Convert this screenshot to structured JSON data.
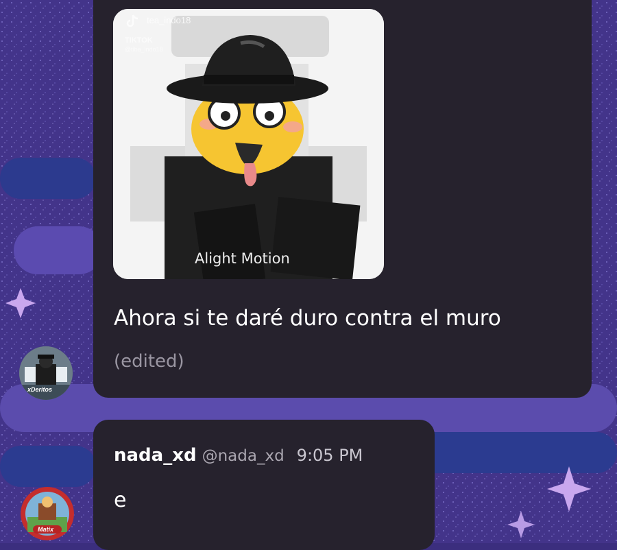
{
  "message1": {
    "media": {
      "watermark_user": "tea_indo18",
      "watermark_brand": "TIKTOK",
      "watermark_handle": "@tiba_indo18",
      "overlay_text": "Alight Motion"
    },
    "text": "Ahora si te daré duro contra el muro",
    "edited_label": "(edited)",
    "avatar_label": "xDeritos"
  },
  "message2": {
    "username": "nada_xd",
    "handle": "@nada_xd",
    "time": "9:05 PM",
    "text": "e",
    "avatar_label": "Matix"
  },
  "colors": {
    "background": "#3b2e7e",
    "bubble": "#26222d",
    "text": "#ffffff",
    "muted": "#9a96a2"
  }
}
